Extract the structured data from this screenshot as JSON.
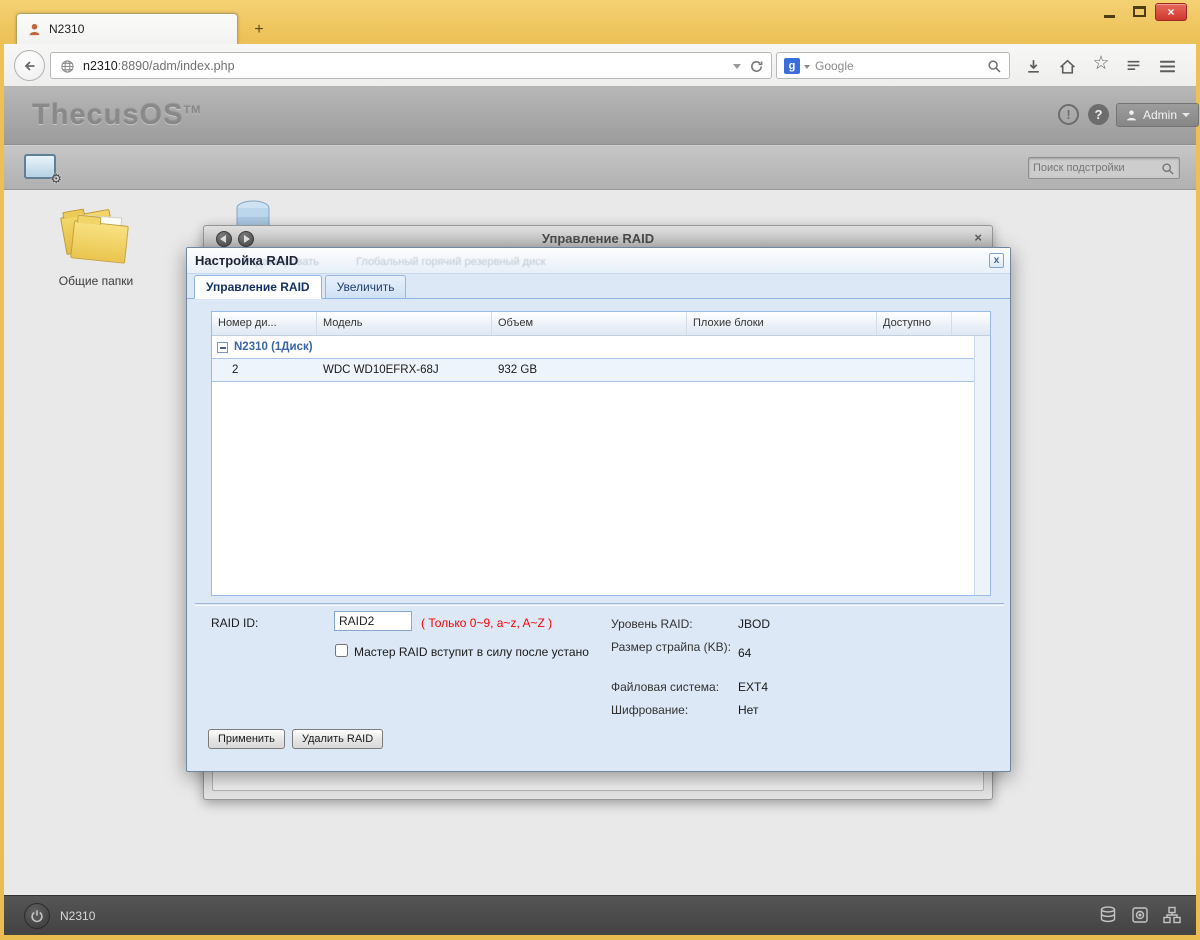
{
  "colors": {
    "frame_gold": "#ecc157",
    "close_red": "#d0372b",
    "dialog_bg": "#dce8f6",
    "accent_blue": "#99bbe8",
    "hint_red": "#ff0000"
  },
  "window_controls": {
    "close_glyph": "×"
  },
  "browser": {
    "tab_title": "N2310",
    "new_tab": "+",
    "url_host": "n2310",
    "url_rest": ":8890/adm/index.php",
    "search_placeholder": "Google"
  },
  "app": {
    "logo": "ThecusOS",
    "logo_sup": "TM",
    "info_glyph": "!",
    "help_glyph": "?",
    "user": "Admin",
    "settings_search_placeholder": "Поиск подстройки"
  },
  "desktop": {
    "shared_folders_label": "Общие папки"
  },
  "raid_window": {
    "title": "Управление RAID",
    "close_glyph": "×",
    "ghost_items": [
      "Редактировать",
      "Глобальный горячий резервный диск"
    ]
  },
  "dialog": {
    "title": "Настройка RAID",
    "close_glyph": "x",
    "tabs": [
      {
        "label": "Управление RAID"
      },
      {
        "label": "Увеличить"
      }
    ],
    "table": {
      "columns": [
        "Номер ди...",
        "Модель",
        "Объем",
        "Плохие блоки",
        "Доступно"
      ],
      "group_label": "N2310 (1Диск)",
      "rows": [
        {
          "number": "2",
          "model": "WDC WD10EFRX-68J",
          "capacity": "932 GB",
          "bad_blocks": "",
          "available": ""
        }
      ]
    },
    "form": {
      "raid_id_label": "RAID ID:",
      "raid_id_value": "RAID2",
      "raid_id_hint": "( Только 0~9, a~z, A~Z )",
      "checkbox_label": "Мастер RAID вступит в силу после устано",
      "props": [
        {
          "label": "Уровень RAID:",
          "value": "JBOD"
        },
        {
          "label": "Размер страйпа (KB):",
          "value": "64"
        },
        {
          "label": "Файловая система:",
          "value": "EXT4"
        },
        {
          "label": "Шифрование:",
          "value": "Нет"
        }
      ]
    },
    "buttons": {
      "apply": "Применить",
      "remove": "Удалить RAID"
    }
  },
  "footer": {
    "device": "N2310"
  }
}
